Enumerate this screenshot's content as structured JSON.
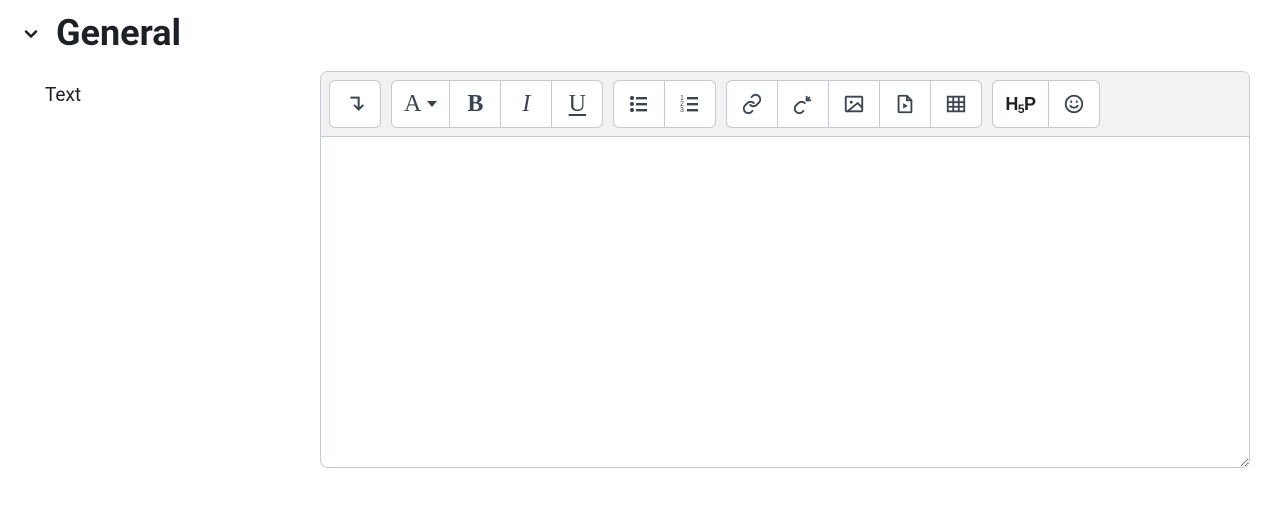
{
  "section": {
    "title": "General"
  },
  "form": {
    "text_label": "Text",
    "editor_value": ""
  },
  "toolbar": {
    "paragraph_letter": "A",
    "bold_letter": "B",
    "italic_letter": "I",
    "underline_letter": "U",
    "h5p_label_pre": "H",
    "h5p_label_sub": "5",
    "h5p_label_post": "P"
  }
}
